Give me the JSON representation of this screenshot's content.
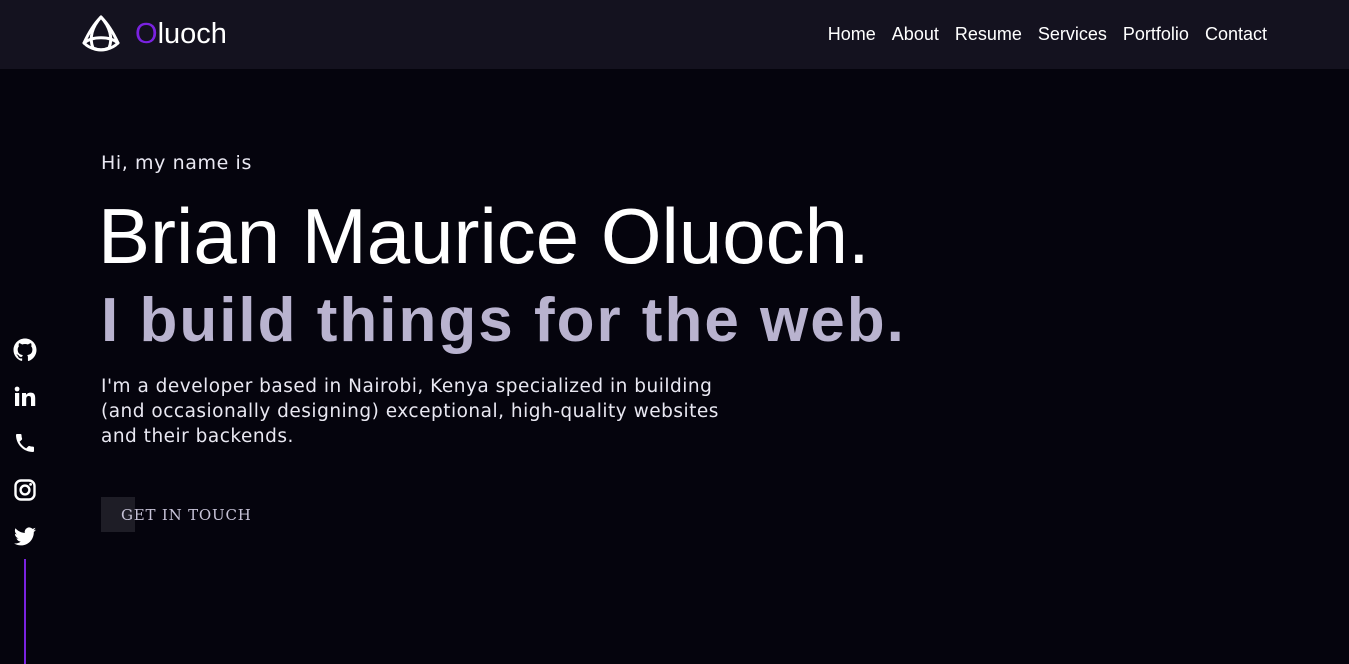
{
  "brand": {
    "logo_icon": "triquetra-icon",
    "initial": "O",
    "rest": "luoch"
  },
  "nav": {
    "items": [
      {
        "label": "Home"
      },
      {
        "label": "About"
      },
      {
        "label": "Resume"
      },
      {
        "label": "Services"
      },
      {
        "label": "Portfolio"
      },
      {
        "label": "Contact"
      }
    ]
  },
  "hero": {
    "greeting": "Hi, my name is",
    "name": "Brian Maurice Oluoch.",
    "tagline": "I build things for the web.",
    "intro": "I'm a developer based in Nairobi, Kenya specialized in building (and occasionally designing) exceptional, high-quality websites and their backends.",
    "cta_label": "GET IN TOUCH"
  },
  "social": {
    "icons": [
      "github-icon",
      "linkedin-icon",
      "phone-icon",
      "instagram-icon",
      "twitter-icon"
    ]
  },
  "colors": {
    "accent": "#7a22e0",
    "background": "#05040d",
    "navbar": "#14121f",
    "tagline": "#b9b3cf"
  }
}
